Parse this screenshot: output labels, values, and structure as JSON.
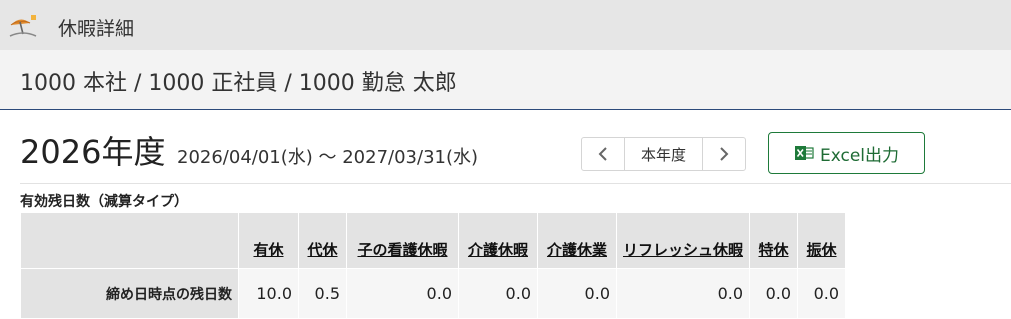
{
  "window": {
    "icon": "beach-umbrella-icon",
    "title": "休暇詳細"
  },
  "breadcrumb": "1000 本社 / 1000 正社員 / 1000 勤怠 太郎",
  "fiscal": {
    "year_label": "2026年度",
    "range": "2026/04/01(水) ～ 2027/03/31(水)"
  },
  "pager": {
    "current_label": "本年度"
  },
  "excel_button": {
    "label": "Excel出力",
    "icon": "excel-icon",
    "color": "#1e7a3a"
  },
  "section": {
    "title": "有効残日数（減算タイプ）"
  },
  "table": {
    "columns": [
      "有休",
      "代休",
      "子の看護休暇",
      "介護休暇",
      "介護休業",
      "リフレッシュ休暇",
      "特休",
      "振休"
    ],
    "rows": [
      {
        "label": "締め日時点の残日数",
        "values": [
          "10.0",
          "0.5",
          "0.0",
          "0.0",
          "0.0",
          "0.0",
          "0.0",
          "0.0"
        ]
      }
    ]
  }
}
